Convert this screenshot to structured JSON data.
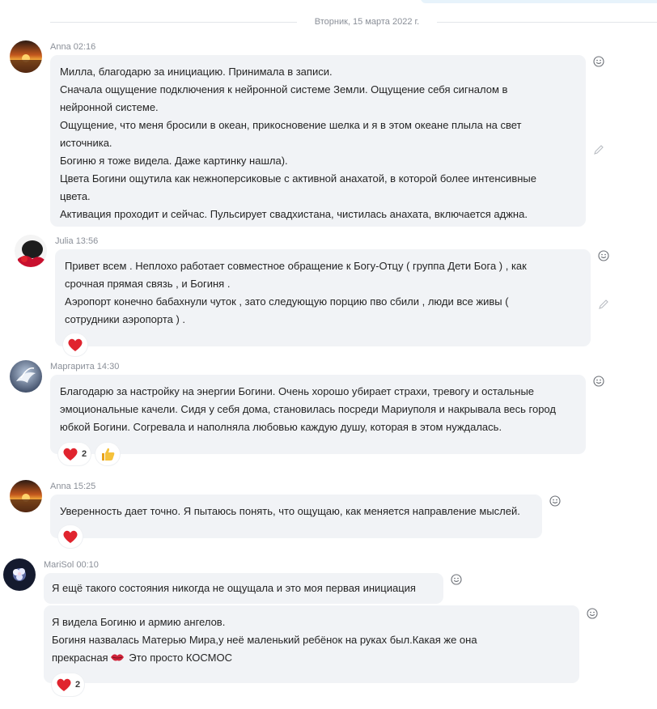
{
  "date_separator": "Вторник, 15 марта 2022 г.",
  "messages": [
    {
      "author": "Anna",
      "time": "02:16",
      "lines": [
        "Милла, благодарю за инициацию. Принимала в записи.",
        "Сначала ощущение подключения к нейронной системе Земли. Ощущение себя сигналом в",
        "нейронной системе.",
        "Ощущение, что меня бросили в океан, прикосновение шелка и я в этом океане плыла на свет",
        "источника.",
        "Богиню я тоже видела. Даже картинку нашла).",
        "Цвета Богини ощутила как нежноперсиковые с активной анахатой, в которой более интенсивные",
        "цвета.",
        "Активация проходит и сейчас. Пульсирует свадхистана, чистилась анахата, включается аджна."
      ]
    },
    {
      "author": "Julia",
      "time": "13:56",
      "lines": [
        "Привет всем . Неплохо работает совместное обращение к Богу-Отцу ( группа Дети Бога ) , как",
        "срочная прямая связь , и Богиня .",
        "Аэропорт конечно бабахнули чуток , зато следующую порцию пво сбили , люди все живы (",
        "сотрудники аэропорта ) ."
      ],
      "reactions": [
        {
          "icon": "heart-icon",
          "count": ""
        }
      ]
    },
    {
      "author": "Маргарита",
      "time": "14:30",
      "lines": [
        "Благодарю за настройку на энергии Богини. Очень хорошо убирает страхи, тревогу и остальные",
        "эмоциональные качели. Сидя у себя дома, становилась посреди Мариуполя и накрывала весь город",
        "юбкой Богини. Согревала и наполняла любовью каждую душу, которая в этом нуждалась."
      ],
      "reactions": [
        {
          "icon": "heart-icon",
          "count": "2"
        },
        {
          "icon": "thumbs-up-icon",
          "count": ""
        }
      ]
    },
    {
      "author": "Anna",
      "time": "15:25",
      "lines": [
        "Уверенность дает точно. Я пытаюсь понять, что ощущаю, как меняется направление мыслей."
      ],
      "reactions": [
        {
          "icon": "heart-icon",
          "count": ""
        }
      ]
    },
    {
      "author": "MariSol",
      "time": "00:10",
      "lines": [
        "Я ещё такого состояния никогда не ощущала и это моя первая инициация"
      ]
    },
    {
      "author": "MariSol",
      "time": "",
      "lines": [
        "Я видела Богиню и армию ангелов.",
        "Богиня назвалась Матерью Мира,у неё  маленький ребёнок на руках был.Какая же она",
        "прекрасная",
        "Это просто КОСМОС"
      ],
      "reactions": [
        {
          "icon": "heart-icon",
          "count": "2"
        }
      ]
    }
  ],
  "colors": {
    "bubble": "#f1f3f6",
    "heart": "#e0242e",
    "meta_text": "#8a8f98"
  }
}
